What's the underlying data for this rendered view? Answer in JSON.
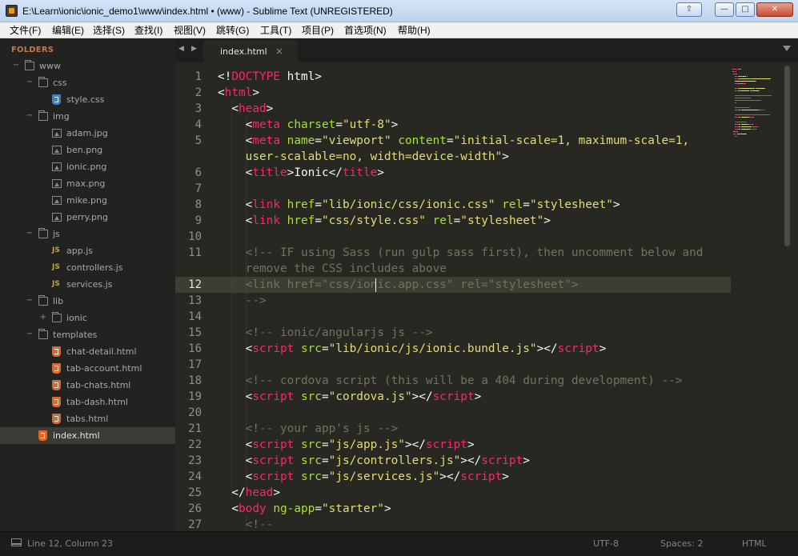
{
  "window": {
    "title": "E:\\Learn\\ionic\\ionic_demo1\\www\\index.html • (www) - Sublime Text (UNREGISTERED)",
    "restore_glyph": "⇧",
    "minimize_glyph": "—",
    "maximize_glyph": "□",
    "close_glyph": "✕"
  },
  "menu": [
    "文件(F)",
    "编辑(E)",
    "选择(S)",
    "查找(I)",
    "视图(V)",
    "跳转(G)",
    "工具(T)",
    "项目(P)",
    "首选项(N)",
    "帮助(H)"
  ],
  "sidebar": {
    "heading": "FOLDERS",
    "items": [
      {
        "label": "www",
        "type": "folder",
        "depth": 0,
        "toggle": "−",
        "icon": "folder-open-icon"
      },
      {
        "label": "css",
        "type": "folder",
        "depth": 1,
        "toggle": "−",
        "icon": "folder-open-icon"
      },
      {
        "label": "style.css",
        "type": "css",
        "depth": 2,
        "icon": "css-file-icon"
      },
      {
        "label": "img",
        "type": "folder",
        "depth": 1,
        "toggle": "−",
        "icon": "folder-open-icon"
      },
      {
        "label": "adam.jpg",
        "type": "img",
        "depth": 2,
        "icon": "image-file-icon"
      },
      {
        "label": "ben.png",
        "type": "img",
        "depth": 2,
        "icon": "image-file-icon"
      },
      {
        "label": "ionic.png",
        "type": "img",
        "depth": 2,
        "icon": "image-file-icon"
      },
      {
        "label": "max.png",
        "type": "img",
        "depth": 2,
        "icon": "image-file-icon"
      },
      {
        "label": "mike.png",
        "type": "img",
        "depth": 2,
        "icon": "image-file-icon"
      },
      {
        "label": "perry.png",
        "type": "img",
        "depth": 2,
        "icon": "image-file-icon"
      },
      {
        "label": "js",
        "type": "folder",
        "depth": 1,
        "toggle": "−",
        "icon": "folder-open-icon"
      },
      {
        "label": "app.js",
        "type": "js",
        "depth": 2,
        "icon": "js-file-icon"
      },
      {
        "label": "controllers.js",
        "type": "js",
        "depth": 2,
        "icon": "js-file-icon"
      },
      {
        "label": "services.js",
        "type": "js",
        "depth": 2,
        "icon": "js-file-icon"
      },
      {
        "label": "lib",
        "type": "folder",
        "depth": 1,
        "toggle": "−",
        "icon": "folder-open-icon"
      },
      {
        "label": "ionic",
        "type": "folder",
        "depth": 2,
        "toggle": "+",
        "icon": "folder-closed-icon"
      },
      {
        "label": "templates",
        "type": "folder",
        "depth": 1,
        "toggle": "−",
        "icon": "folder-open-icon"
      },
      {
        "label": "chat-detail.html",
        "type": "html",
        "depth": 2,
        "icon": "html-file-icon"
      },
      {
        "label": "tab-account.html",
        "type": "html",
        "depth": 2,
        "icon": "html-file-icon"
      },
      {
        "label": "tab-chats.html",
        "type": "html",
        "depth": 2,
        "icon": "html-file-icon"
      },
      {
        "label": "tab-dash.html",
        "type": "html",
        "depth": 2,
        "icon": "html-file-icon"
      },
      {
        "label": "tabs.html",
        "type": "html",
        "depth": 2,
        "icon": "html-file-icon"
      },
      {
        "label": "index.html",
        "type": "html",
        "depth": 1,
        "icon": "html-file-icon",
        "selected": true
      }
    ]
  },
  "tabs": {
    "prev_glyph": "◀",
    "next_glyph": "▶",
    "active_label": "index.html",
    "close_glyph": "×"
  },
  "editor": {
    "current_line": 12,
    "line_numbers": [
      "1",
      "2",
      "3",
      "4",
      "5",
      "",
      "6",
      "7",
      "8",
      "9",
      "10",
      "11",
      "",
      "12",
      "13",
      "14",
      "15",
      "16",
      "17",
      "18",
      "19",
      "20",
      "21",
      "22",
      "23",
      "24",
      "25",
      "26",
      "27"
    ],
    "lines": [
      [
        [
          "t",
          "<!"
        ],
        [
          "tg",
          "DOCTYPE"
        ],
        [
          "t",
          " html>"
        ]
      ],
      [
        [
          "t",
          "<"
        ],
        [
          "tg",
          "html"
        ],
        [
          "t",
          ">"
        ]
      ],
      [
        [
          "t",
          "  <"
        ],
        [
          "tg",
          "head"
        ],
        [
          "t",
          ">"
        ]
      ],
      [
        [
          "t",
          "    <"
        ],
        [
          "tg",
          "meta"
        ],
        [
          "t",
          " "
        ],
        [
          "at",
          "charset"
        ],
        [
          "t",
          "="
        ],
        [
          "st",
          "\"utf-8\""
        ],
        [
          "t",
          ">"
        ]
      ],
      [
        [
          "t",
          "    <"
        ],
        [
          "tg",
          "meta"
        ],
        [
          "t",
          " "
        ],
        [
          "at",
          "name"
        ],
        [
          "t",
          "="
        ],
        [
          "st",
          "\"viewport\""
        ],
        [
          "t",
          " "
        ],
        [
          "at",
          "content"
        ],
        [
          "t",
          "="
        ],
        [
          "st",
          "\"initial-scale=1, maximum-scale=1,"
        ]
      ],
      [
        [
          "st",
          "    user-scalable=no, width=device-width\""
        ],
        [
          "t",
          ">"
        ]
      ],
      [
        [
          "t",
          "    <"
        ],
        [
          "tg",
          "title"
        ],
        [
          "t",
          ">Ionic</"
        ],
        [
          "tg",
          "title"
        ],
        [
          "t",
          ">"
        ]
      ],
      [
        [
          "t",
          ""
        ]
      ],
      [
        [
          "t",
          "    <"
        ],
        [
          "tg",
          "link"
        ],
        [
          "t",
          " "
        ],
        [
          "at",
          "href"
        ],
        [
          "t",
          "="
        ],
        [
          "st",
          "\"lib/ionic/css/ionic.css\""
        ],
        [
          "t",
          " "
        ],
        [
          "at",
          "rel"
        ],
        [
          "t",
          "="
        ],
        [
          "st",
          "\"stylesheet\""
        ],
        [
          "t",
          ">"
        ]
      ],
      [
        [
          "t",
          "    <"
        ],
        [
          "tg",
          "link"
        ],
        [
          "t",
          " "
        ],
        [
          "at",
          "href"
        ],
        [
          "t",
          "="
        ],
        [
          "st",
          "\"css/style.css\""
        ],
        [
          "t",
          " "
        ],
        [
          "at",
          "rel"
        ],
        [
          "t",
          "="
        ],
        [
          "st",
          "\"stylesheet\""
        ],
        [
          "t",
          ">"
        ]
      ],
      [
        [
          "t",
          ""
        ]
      ],
      [
        [
          "cm",
          "    <!-- IF using Sass (run gulp sass first), then uncomment below and"
        ]
      ],
      [
        [
          "cm",
          "    remove the CSS includes above"
        ]
      ],
      [
        [
          "cm",
          "    <link href=\"css/ionic.app.css\" rel=\"stylesheet\">"
        ]
      ],
      [
        [
          "cm",
          "    -->"
        ]
      ],
      [
        [
          "t",
          ""
        ]
      ],
      [
        [
          "cm",
          "    <!-- ionic/angularjs js -->"
        ]
      ],
      [
        [
          "t",
          "    <"
        ],
        [
          "tg",
          "script"
        ],
        [
          "t",
          " "
        ],
        [
          "at",
          "src"
        ],
        [
          "t",
          "="
        ],
        [
          "st",
          "\"lib/ionic/js/ionic.bundle.js\""
        ],
        [
          "t",
          "></"
        ],
        [
          "tg",
          "script"
        ],
        [
          "t",
          ">"
        ]
      ],
      [
        [
          "t",
          ""
        ]
      ],
      [
        [
          "cm",
          "    <!-- cordova script (this will be a 404 during development) -->"
        ]
      ],
      [
        [
          "t",
          "    <"
        ],
        [
          "tg",
          "script"
        ],
        [
          "t",
          " "
        ],
        [
          "at",
          "src"
        ],
        [
          "t",
          "="
        ],
        [
          "st",
          "\"cordova.js\""
        ],
        [
          "t",
          "></"
        ],
        [
          "tg",
          "script"
        ],
        [
          "t",
          ">"
        ]
      ],
      [
        [
          "t",
          ""
        ]
      ],
      [
        [
          "cm",
          "    <!-- your app's js -->"
        ]
      ],
      [
        [
          "t",
          "    <"
        ],
        [
          "tg",
          "script"
        ],
        [
          "t",
          " "
        ],
        [
          "at",
          "src"
        ],
        [
          "t",
          "="
        ],
        [
          "st",
          "\"js/app.js\""
        ],
        [
          "t",
          "></"
        ],
        [
          "tg",
          "script"
        ],
        [
          "t",
          ">"
        ]
      ],
      [
        [
          "t",
          "    <"
        ],
        [
          "tg",
          "script"
        ],
        [
          "t",
          " "
        ],
        [
          "at",
          "src"
        ],
        [
          "t",
          "="
        ],
        [
          "st",
          "\"js/controllers.js\""
        ],
        [
          "t",
          "></"
        ],
        [
          "tg",
          "script"
        ],
        [
          "t",
          ">"
        ]
      ],
      [
        [
          "t",
          "    <"
        ],
        [
          "tg",
          "script"
        ],
        [
          "t",
          " "
        ],
        [
          "at",
          "src"
        ],
        [
          "t",
          "="
        ],
        [
          "st",
          "\"js/services.js\""
        ],
        [
          "t",
          "></"
        ],
        [
          "tg",
          "script"
        ],
        [
          "t",
          ">"
        ]
      ],
      [
        [
          "t",
          "  </"
        ],
        [
          "tg",
          "head"
        ],
        [
          "t",
          ">"
        ]
      ],
      [
        [
          "t",
          "  <"
        ],
        [
          "tg",
          "body"
        ],
        [
          "t",
          " "
        ],
        [
          "at",
          "ng-app"
        ],
        [
          "t",
          "="
        ],
        [
          "st",
          "\"starter\""
        ],
        [
          "t",
          ">"
        ]
      ],
      [
        [
          "cm",
          "    <!--"
        ]
      ]
    ]
  },
  "status": {
    "position": "Line 12, Column 23",
    "encoding": "UTF-8",
    "indent": "Spaces: 2",
    "syntax": "HTML"
  },
  "colors": {
    "tag": "#f92672",
    "attribute": "#a6e22e",
    "string": "#e6db74",
    "comment": "#75715e",
    "text": "#f8f8f2",
    "background": "#272822"
  }
}
